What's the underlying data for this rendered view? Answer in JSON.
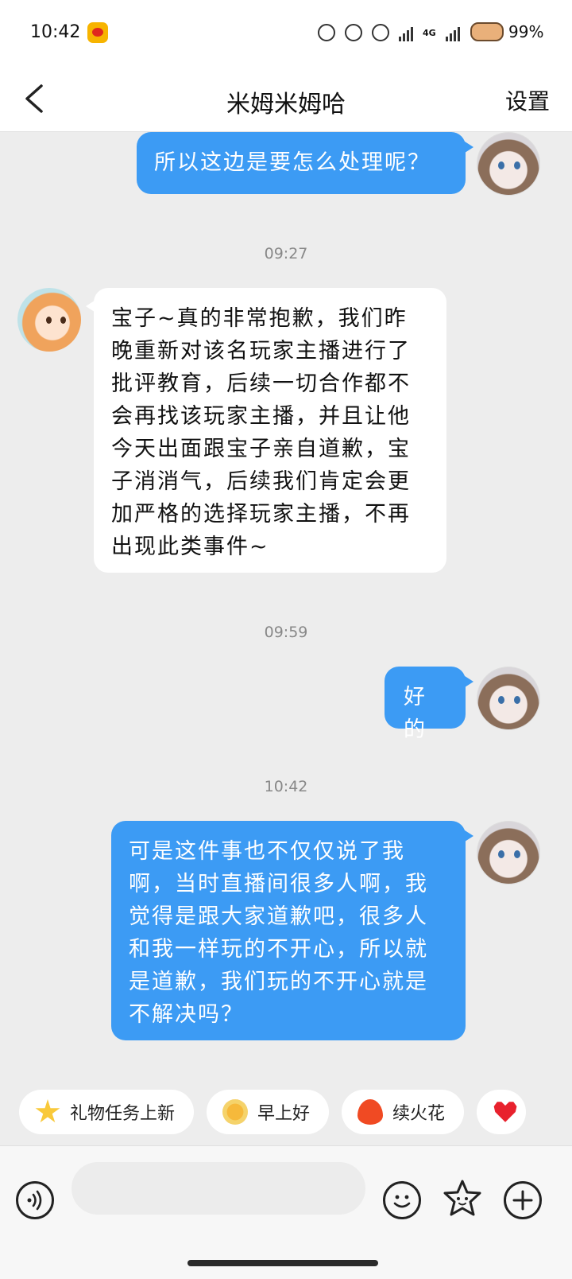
{
  "status_bar": {
    "time": "10:42",
    "network": "4G",
    "battery": "99%"
  },
  "header": {
    "title": "米姆米姆哈",
    "settings_label": "设置"
  },
  "messages": [
    {
      "side": "me",
      "text": "所以这边是要怎么处理呢？"
    },
    {
      "timestamp": "09:27"
    },
    {
      "side": "other",
      "text": "宝子~真的非常抱歉，我们昨晚重新对该名玩家主播进行了批评教育，后续一切合作都不会再找该玩家主播，并且让他今天出面跟宝子亲自道歉，宝子消消气，后续我们肯定会更加严格的选择玩家主播，不再出现此类事件~"
    },
    {
      "timestamp": "09:59"
    },
    {
      "side": "me",
      "text": "好的"
    },
    {
      "timestamp": "10:42"
    },
    {
      "side": "me",
      "text": "可是这件事也不仅仅说了我啊，当时直播间很多人啊，我觉得是跟大家道歉吧，很多人和我一样玩的不开心，所以就是道歉，我们玩的不开心就是不解决吗？"
    }
  ],
  "quick_replies": [
    {
      "label": "礼物任务上新",
      "icon": "star-icon"
    },
    {
      "label": "早上好",
      "icon": "sun-icon"
    },
    {
      "label": "续火花",
      "icon": "fire-icon"
    },
    {
      "label": "",
      "icon": "heart-icon"
    }
  ],
  "input_bar": {
    "placeholder": ""
  }
}
